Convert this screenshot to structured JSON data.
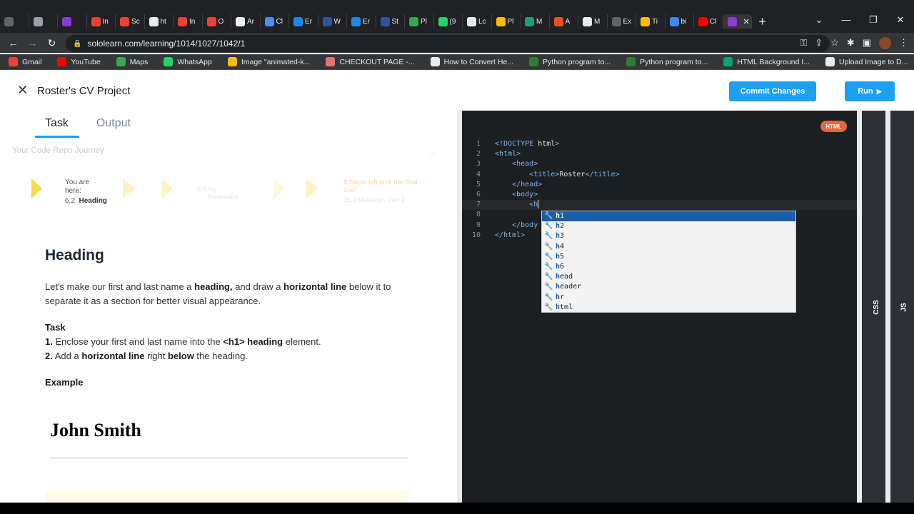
{
  "browser": {
    "tabs": [
      {
        "label": "",
        "color": "#5f6368"
      },
      {
        "label": "",
        "color": "#9aa0a6"
      },
      {
        "label": "",
        "color": "#8e3ad6"
      },
      {
        "label": "In",
        "color": "#ea4335"
      },
      {
        "label": "Sc",
        "color": "#ea4335"
      },
      {
        "label": "ht",
        "color": "#e8eaed"
      },
      {
        "label": "In",
        "color": "#ea4335"
      },
      {
        "label": "O",
        "color": "#ea4335"
      },
      {
        "label": "Ar",
        "color": "#f0f0f0"
      },
      {
        "label": "Cl",
        "color": "#4c8bf5"
      },
      {
        "label": "Er",
        "color": "#1e88e5"
      },
      {
        "label": "W",
        "color": "#2b579a"
      },
      {
        "label": "Er",
        "color": "#1e88e5"
      },
      {
        "label": "St",
        "color": "#2b579a"
      },
      {
        "label": "Pl",
        "color": "#34a853"
      },
      {
        "label": "(9",
        "color": "#25d366"
      },
      {
        "label": "Lc",
        "color": "#e8eaed"
      },
      {
        "label": "Pl",
        "color": "#fbbc04"
      },
      {
        "label": "M",
        "color": "#1b9e77"
      },
      {
        "label": "A",
        "color": "#f25022"
      },
      {
        "label": "M",
        "color": "#e8eaed"
      },
      {
        "label": "Ex",
        "color": "#5f6368"
      },
      {
        "label": "Ti",
        "color": "#fbbc04"
      },
      {
        "label": "bi",
        "color": "#4285f4"
      },
      {
        "label": "Cl",
        "color": "#ff0000"
      },
      {
        "label": "",
        "color": "#8e3ad6",
        "active": true
      }
    ],
    "url": "sololearn.com/learning/1014/1027/1042/1",
    "bookmarks": [
      {
        "label": "Gmail",
        "color": "#ea4335"
      },
      {
        "label": "YouTube",
        "color": "#ff0000"
      },
      {
        "label": "Maps",
        "color": "#34a853"
      },
      {
        "label": "WhatsApp",
        "color": "#25d366"
      },
      {
        "label": "Image \"animated-k...",
        "color": "#fbbc04"
      },
      {
        "label": "CHECKOUT PAGE -...",
        "color": "#e57373"
      },
      {
        "label": "How to Convert He...",
        "color": "#e8eaed"
      },
      {
        "label": "Python program to...",
        "color": "#2e7d32"
      },
      {
        "label": "Python program to...",
        "color": "#2e7d32"
      },
      {
        "label": "HTML Background I...",
        "color": "#00a86b"
      },
      {
        "label": "Upload Image to D...",
        "color": "#e8eaed"
      }
    ]
  },
  "header": {
    "close_icon": "✕",
    "title": "Roster's CV Project",
    "commit_label": "Commit Changes",
    "run_label": "Run"
  },
  "left": {
    "tabs": [
      "Task",
      "Output"
    ],
    "journey_title": "Your Code Repo Journey",
    "you_are_here": "You are here:",
    "current_step_no": "6.2",
    "current_step": "Heading",
    "next_step_no": "6.3",
    "next_step": "My Profession",
    "later_step_no": "25.2",
    "later_step": "Message, Part 2",
    "steps_left": "8 Steps left until the final one!",
    "heading": "Heading",
    "intro_pre": "Let's make our first and last name a ",
    "intro_b1": "heading,",
    "intro_mid": " and draw a ",
    "intro_b2": "horizontal line",
    "intro_post": " below it to separate it as a section for better visual appearance.",
    "task_title": "Task",
    "task1_no": "1.",
    "task1_pre": " Enclose your first and last name into the ",
    "task1_b": "<h1> heading",
    "task1_post": " element.",
    "task2_no": "2.",
    "task2_pre": " Add a ",
    "task2_b1": "horizontal line",
    "task2_mid": " right ",
    "task2_b2": "below",
    "task2_post": " the heading.",
    "example_title": "Example",
    "example_name": "John Smith"
  },
  "editor": {
    "badge": "HTML",
    "lines": [
      {
        "n": "1",
        "indent": "",
        "parts": [
          [
            "tag",
            "<!DOCTYPE "
          ],
          [
            "txt",
            "html"
          ],
          [
            "tag",
            ">"
          ]
        ]
      },
      {
        "n": "2",
        "indent": "",
        "parts": [
          [
            "tag",
            "<html>"
          ]
        ]
      },
      {
        "n": "3",
        "indent": "    ",
        "parts": [
          [
            "tag",
            "<head>"
          ]
        ]
      },
      {
        "n": "4",
        "indent": "        ",
        "parts": [
          [
            "tag",
            "<title>"
          ],
          [
            "txt",
            "Roster"
          ],
          [
            "tag",
            "</title>"
          ]
        ]
      },
      {
        "n": "5",
        "indent": "    ",
        "parts": [
          [
            "tag",
            "</head>"
          ]
        ]
      },
      {
        "n": "6",
        "indent": "    ",
        "parts": [
          [
            "tag",
            "<body>"
          ]
        ]
      },
      {
        "n": "7",
        "indent": "        ",
        "parts": [
          [
            "tag",
            "<h"
          ]
        ],
        "cursor": true
      },
      {
        "n": "8",
        "indent": "",
        "parts": []
      },
      {
        "n": "9",
        "indent": "    ",
        "parts": [
          [
            "tag",
            "</body"
          ]
        ]
      },
      {
        "n": "10",
        "indent": "",
        "parts": [
          [
            "tag",
            "</html>"
          ]
        ]
      }
    ],
    "autocomplete": [
      "h1",
      "h2",
      "h3",
      "h4",
      "h5",
      "h6",
      "head",
      "header",
      "hr",
      "html"
    ],
    "side_css": "CSS",
    "side_js": "JS"
  }
}
